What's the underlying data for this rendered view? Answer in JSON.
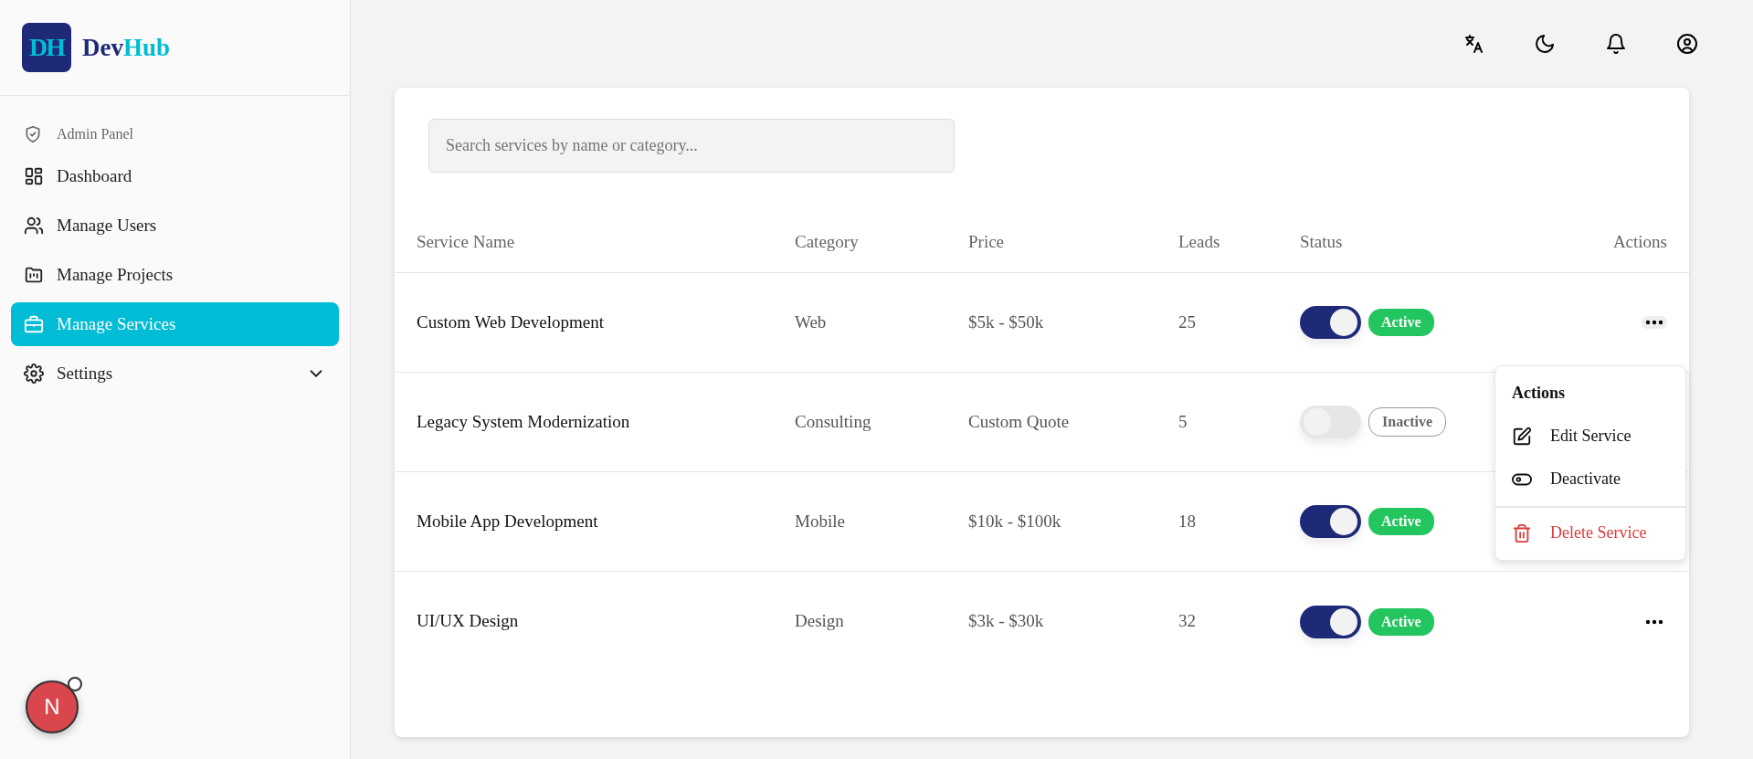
{
  "brand": {
    "mark": "DH",
    "name_first": "Dev",
    "name_second": "Hub"
  },
  "sidebar": {
    "section_label": "Admin Panel",
    "items": [
      {
        "label": "Dashboard",
        "selected": false,
        "expandable": false
      },
      {
        "label": "Manage Users",
        "selected": false,
        "expandable": false
      },
      {
        "label": "Manage Projects",
        "selected": false,
        "expandable": false
      },
      {
        "label": "Manage Services",
        "selected": true,
        "expandable": false
      },
      {
        "label": "Settings",
        "selected": false,
        "expandable": true
      }
    ]
  },
  "search": {
    "placeholder": "Search services by name or category..."
  },
  "table": {
    "columns": [
      "Service Name",
      "Category",
      "Price",
      "Leads",
      "Status",
      "Actions"
    ],
    "rows": [
      {
        "name": "Custom Web Development",
        "category": "Web",
        "price": "$5k - $50k",
        "leads": "25",
        "on": true,
        "status": "Active",
        "menu_open": true
      },
      {
        "name": "Legacy System Modernization",
        "category": "Consulting",
        "price": "Custom Quote",
        "leads": "5",
        "on": false,
        "status": "Inactive",
        "menu_open": false
      },
      {
        "name": "Mobile App Development",
        "category": "Mobile",
        "price": "$10k - $100k",
        "leads": "18",
        "on": true,
        "status": "Active",
        "menu_open": false
      },
      {
        "name": "UI/UX Design",
        "category": "Design",
        "price": "$3k - $30k",
        "leads": "32",
        "on": true,
        "status": "Active",
        "menu_open": false
      }
    ]
  },
  "actions_menu": {
    "title": "Actions",
    "items": [
      {
        "label": "Edit Service",
        "kind": "edit"
      },
      {
        "label": "Deactivate",
        "kind": "toggle"
      },
      {
        "label": "Delete Service",
        "kind": "delete"
      }
    ]
  },
  "dev_badge": {
    "label": "N"
  }
}
